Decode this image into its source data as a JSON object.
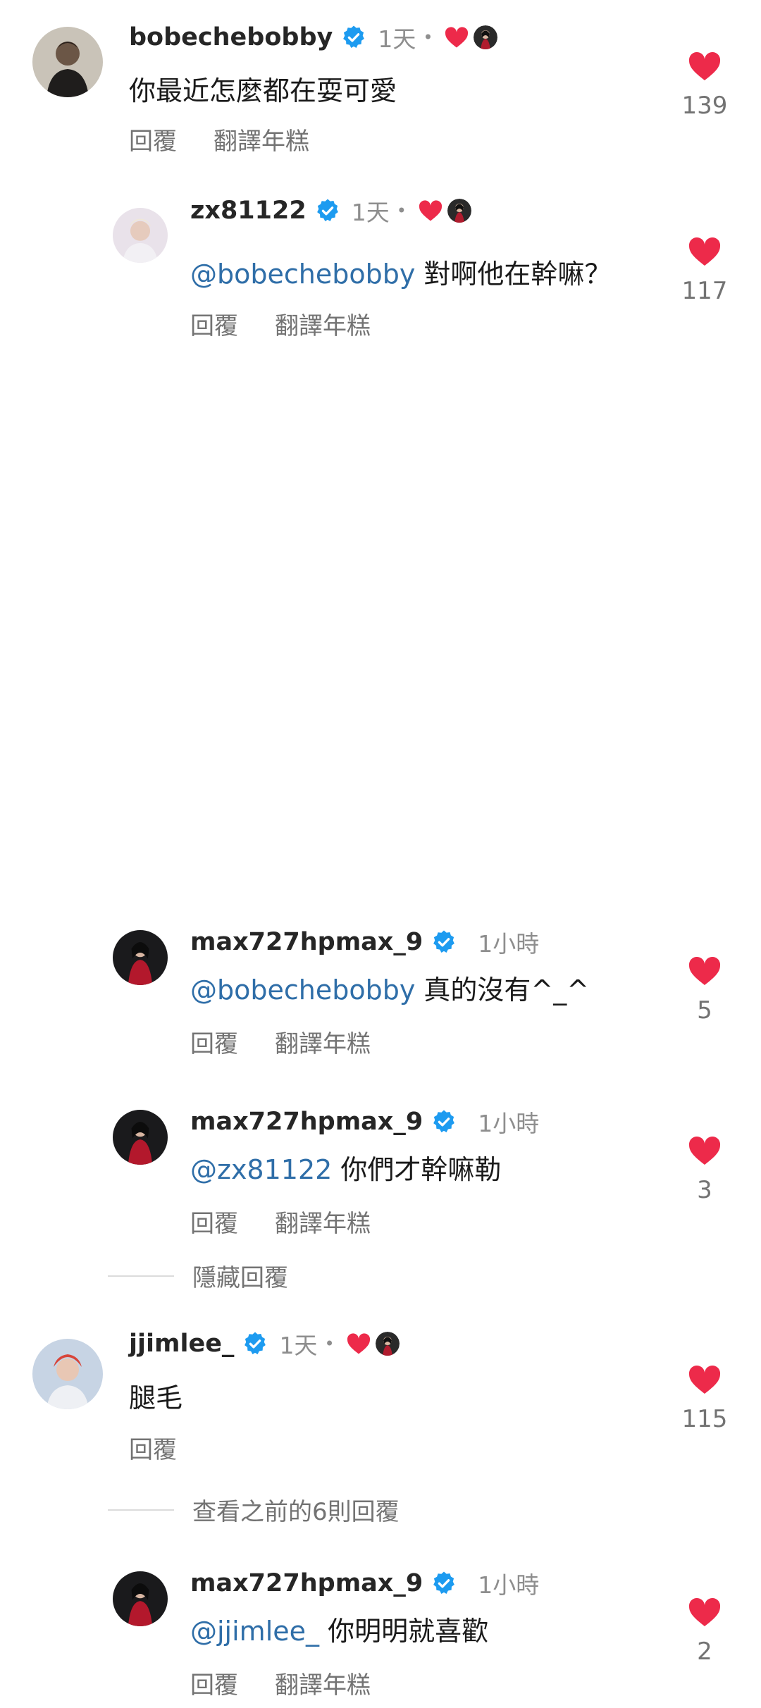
{
  "colors": {
    "heart": "#ed2a4a",
    "mention": "#2f6ea8",
    "verified": "#1d9bf0",
    "muted": "#8e8e8e"
  },
  "icons": {
    "like": "heart-icon",
    "verified": "verified-badge-icon",
    "creator_liked": "creator-liked-heart-icon"
  },
  "comments": [
    {
      "username": "bobechebobby",
      "verified": true,
      "time": "1天",
      "separator": "•",
      "creator_liked": true,
      "mention": "",
      "text": "你最近怎麼都在耍可愛",
      "reply_label": "回覆",
      "translate_label": "翻譯年糕",
      "likes": "139"
    },
    {
      "username": "zx81122",
      "verified": true,
      "time": "1天",
      "separator": "•",
      "creator_liked": true,
      "mention": "@bobechebobby",
      "text": "對啊他在幹嘛？",
      "reply_label": "回覆",
      "translate_label": "翻譯年糕",
      "likes": "117"
    },
    {
      "username": "max727hpmax_9",
      "verified": true,
      "time": "1小時",
      "mention": "@bobechebobby",
      "text": "真的沒有^_^",
      "reply_label": "回覆",
      "translate_label": "翻譯年糕",
      "likes": "5"
    },
    {
      "username": "max727hpmax_9",
      "verified": true,
      "time": "1小時",
      "mention": "@zx81122",
      "text": "你們才幹嘛勒",
      "reply_label": "回覆",
      "translate_label": "翻譯年糕",
      "likes": "3"
    },
    {
      "username": "jjimlee_",
      "verified": true,
      "time": "1天",
      "separator": "•",
      "creator_liked": true,
      "mention": "",
      "text": "腿毛",
      "reply_label": "回覆",
      "likes": "115"
    },
    {
      "username": "max727hpmax_9",
      "verified": true,
      "time": "1小時",
      "mention": "@jjimlee_",
      "text": "你明明就喜歡",
      "reply_label": "回覆",
      "translate_label": "翻譯年糕",
      "likes": "2"
    }
  ],
  "thread_controls": {
    "hide_replies": "隱藏回覆",
    "view_previous": "查看之前的6則回覆"
  }
}
